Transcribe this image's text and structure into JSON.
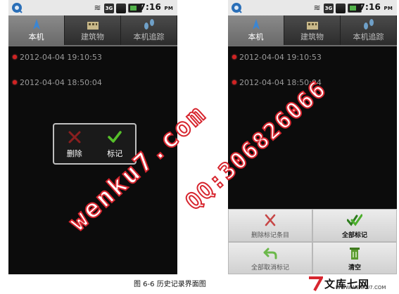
{
  "status_bar": {
    "time": "7:16",
    "ampm": "PM",
    "network_badge": "3G"
  },
  "tabs": [
    {
      "label": "本机",
      "icon": "compass-arrow-icon"
    },
    {
      "label": "建筑物",
      "icon": "building-icon"
    },
    {
      "label": "本机追踪",
      "icon": "footprints-icon"
    }
  ],
  "history_items": [
    {
      "timestamp": "2012-04-04 19:10:53"
    },
    {
      "timestamp": "2012-04-04 18:50:04"
    }
  ],
  "popup": {
    "delete_label": "删除",
    "mark_label": "标记"
  },
  "menu": {
    "delete_marked_label": "删除标记条目",
    "mark_all_label": "全部标记",
    "unmark_all_label": "全部取消标记",
    "clear_label": "清空"
  },
  "watermark": {
    "site": "wenku7.com",
    "qq": "QQ:306826066"
  },
  "caption": "图 6-6  历史记录界面图",
  "brand": {
    "name": "文库七网",
    "url": "WWW.WENKU7.COM"
  },
  "colors": {
    "active_tab": "#7b7b7b",
    "watermark": "#d7262f",
    "record_dot": "#d32222"
  }
}
